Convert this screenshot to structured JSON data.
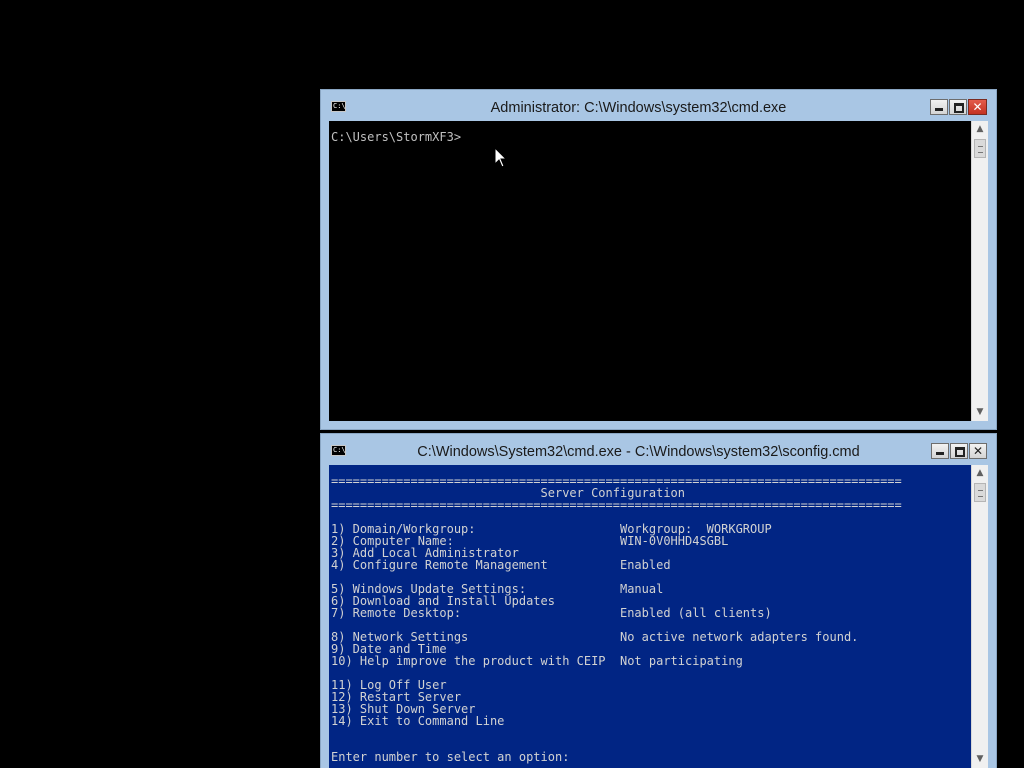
{
  "top_window": {
    "title": "Administrator: C:\\Windows\\system32\\cmd.exe",
    "icon_text": "C:\\",
    "console_lines": [
      "C:\\Users\\StormXF3>"
    ]
  },
  "bottom_window": {
    "title": "C:\\Windows\\System32\\cmd.exe - C:\\Windows\\system32\\sconfig.cmd",
    "icon_text": "C:\\",
    "console_lines": [
      "===============================================================================",
      "                             Server Configuration",
      "===============================================================================",
      "",
      "1) Domain/Workgroup:                    Workgroup:  WORKGROUP",
      "2) Computer Name:                       WIN-0V0HHD4SGBL",
      "3) Add Local Administrator",
      "4) Configure Remote Management          Enabled",
      "",
      "5) Windows Update Settings:             Manual",
      "6) Download and Install Updates",
      "7) Remote Desktop:                      Enabled (all clients)",
      "",
      "8) Network Settings                     No active network adapters found.",
      "9) Date and Time",
      "10) Help improve the product with CEIP  Not participating",
      "",
      "11) Log Off User",
      "12) Restart Server",
      "13) Shut Down Server",
      "14) Exit to Command Line",
      "",
      "",
      "Enter number to select an option:"
    ]
  },
  "caption_buttons": {
    "minimize": "−",
    "maximize": "□",
    "close": "✕"
  },
  "scroll_arrows": {
    "up": "▲",
    "down": "▼"
  },
  "colors": {
    "desktop": "#000000",
    "window_frame": "#a9c6e4",
    "console_black": "#000000",
    "console_blue": "#012584",
    "close_button": "#c43222"
  }
}
